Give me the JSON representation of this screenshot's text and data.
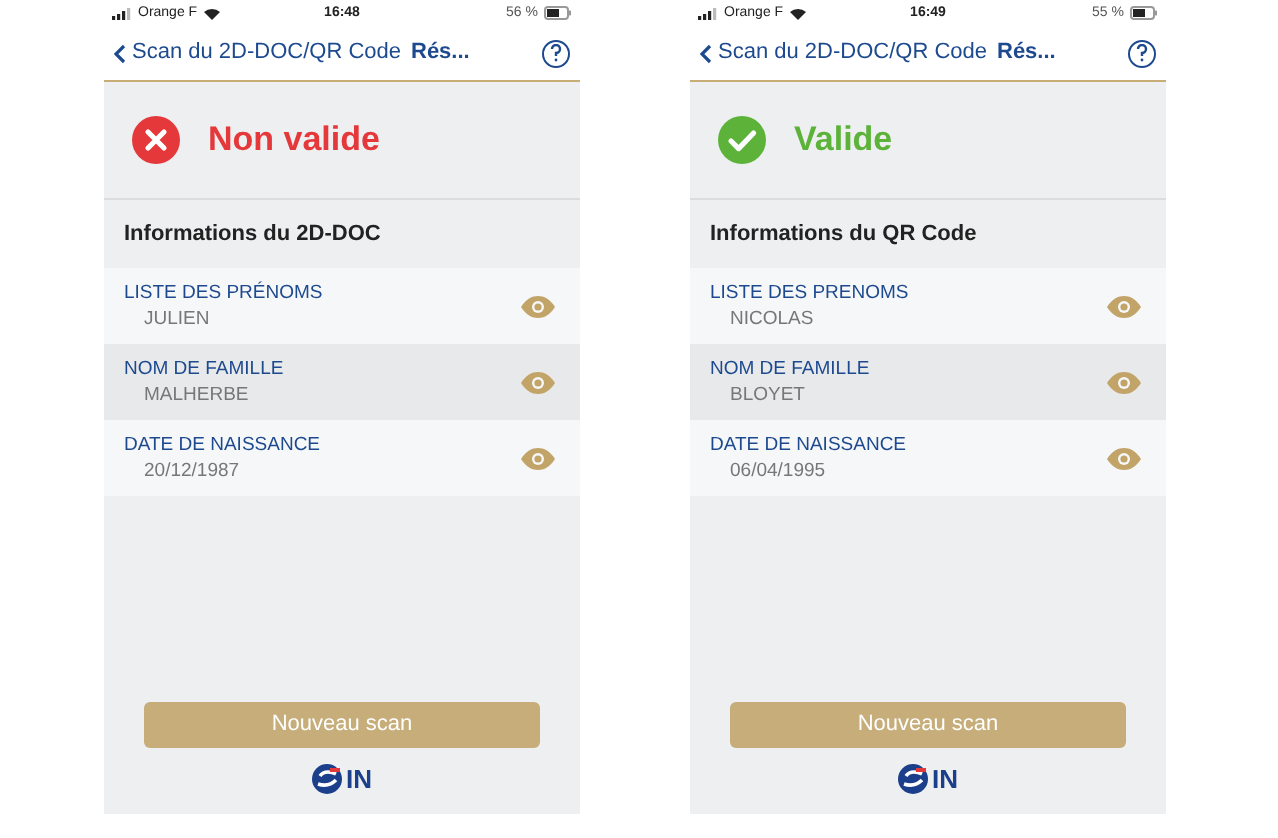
{
  "screens": [
    {
      "status_bar": {
        "carrier": "Orange F",
        "time": "16:48",
        "battery": "56 %"
      },
      "nav": {
        "back_label": "Scan du 2D-DOC/QR Code",
        "title": "Rés..."
      },
      "result": {
        "kind": "invalid",
        "label": "Non valide"
      },
      "section_title": "Informations du 2D-DOC",
      "fields": [
        {
          "label": "LISTE DES PRÉNOMS",
          "value": "JULIEN"
        },
        {
          "label": "NOM DE FAMILLE",
          "value": "MALHERBE"
        },
        {
          "label": "DATE DE NAISSANCE",
          "value": "20/12/1987"
        }
      ],
      "button": "Nouveau scan",
      "logo": "IN"
    },
    {
      "status_bar": {
        "carrier": "Orange F",
        "time": "16:49",
        "battery": "55 %"
      },
      "nav": {
        "back_label": "Scan du 2D-DOC/QR Code",
        "title": "Rés..."
      },
      "result": {
        "kind": "valid",
        "label": "Valide"
      },
      "section_title": "Informations du QR Code",
      "fields": [
        {
          "label": "LISTE DES PRENOMS",
          "value": "NICOLAS"
        },
        {
          "label": "NOM DE FAMILLE",
          "value": "BLOYET"
        },
        {
          "label": "DATE DE NAISSANCE",
          "value": "06/04/1995"
        }
      ],
      "button": "Nouveau scan",
      "logo": "IN"
    }
  ]
}
